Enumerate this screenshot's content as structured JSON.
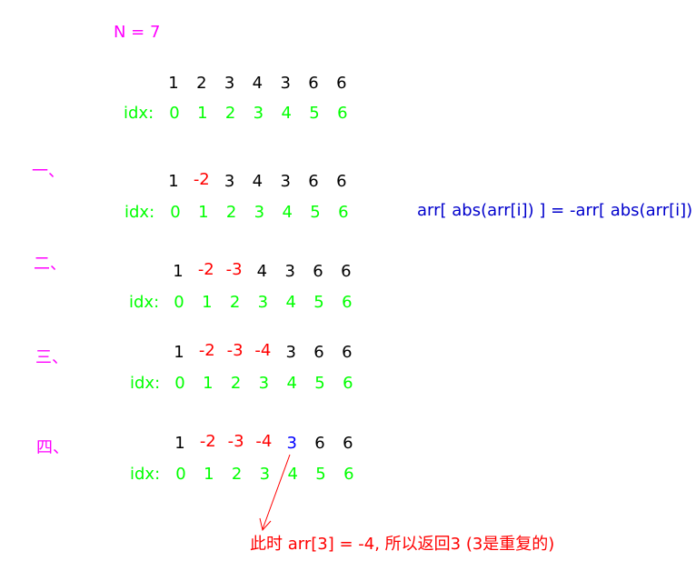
{
  "header": {
    "label": "N = 7"
  },
  "index_label": "idx:",
  "indices": [
    "0",
    "1",
    "2",
    "3",
    "4",
    "5",
    "6"
  ],
  "initial": {
    "values": [
      {
        "text": "1",
        "tone": "black"
      },
      {
        "text": "2",
        "tone": "black"
      },
      {
        "text": "3",
        "tone": "black"
      },
      {
        "text": "4",
        "tone": "black"
      },
      {
        "text": "3",
        "tone": "black"
      },
      {
        "text": "6",
        "tone": "black"
      },
      {
        "text": "6",
        "tone": "black"
      }
    ]
  },
  "steps": [
    {
      "label": "一、",
      "values": [
        {
          "text": "1",
          "tone": "black"
        },
        {
          "text": "-2",
          "tone": "red"
        },
        {
          "text": "3",
          "tone": "black"
        },
        {
          "text": "4",
          "tone": "black"
        },
        {
          "text": "3",
          "tone": "black"
        },
        {
          "text": "6",
          "tone": "black"
        },
        {
          "text": "6",
          "tone": "black"
        }
      ]
    },
    {
      "label": "二、",
      "values": [
        {
          "text": "1",
          "tone": "black"
        },
        {
          "text": "-2",
          "tone": "red"
        },
        {
          "text": "-3",
          "tone": "red"
        },
        {
          "text": "4",
          "tone": "black"
        },
        {
          "text": "3",
          "tone": "black"
        },
        {
          "text": "6",
          "tone": "black"
        },
        {
          "text": "6",
          "tone": "black"
        }
      ]
    },
    {
      "label": "三、",
      "values": [
        {
          "text": "1",
          "tone": "black"
        },
        {
          "text": "-2",
          "tone": "red"
        },
        {
          "text": "-3",
          "tone": "red"
        },
        {
          "text": "-4",
          "tone": "red"
        },
        {
          "text": "3",
          "tone": "black"
        },
        {
          "text": "6",
          "tone": "black"
        },
        {
          "text": "6",
          "tone": "black"
        }
      ]
    },
    {
      "label": "四、",
      "values": [
        {
          "text": "1",
          "tone": "black"
        },
        {
          "text": "-2",
          "tone": "red"
        },
        {
          "text": "-3",
          "tone": "red"
        },
        {
          "text": "-4",
          "tone": "red"
        },
        {
          "text": "3",
          "tone": "blue"
        },
        {
          "text": "6",
          "tone": "black"
        },
        {
          "text": "6",
          "tone": "black"
        }
      ]
    }
  ],
  "formula": "arr[ abs(arr[i]) ] = -arr[ abs(arr[i]) ]",
  "conclusion": "此时 arr[3] = -4, 所以返回3 (3是重复的)",
  "colors": {
    "default": "#000000",
    "marked": "#ff0000",
    "duplicate": "#0000ff",
    "index": "#00ff00",
    "step_label": "#ff00ff",
    "formula": "#0000cc"
  }
}
